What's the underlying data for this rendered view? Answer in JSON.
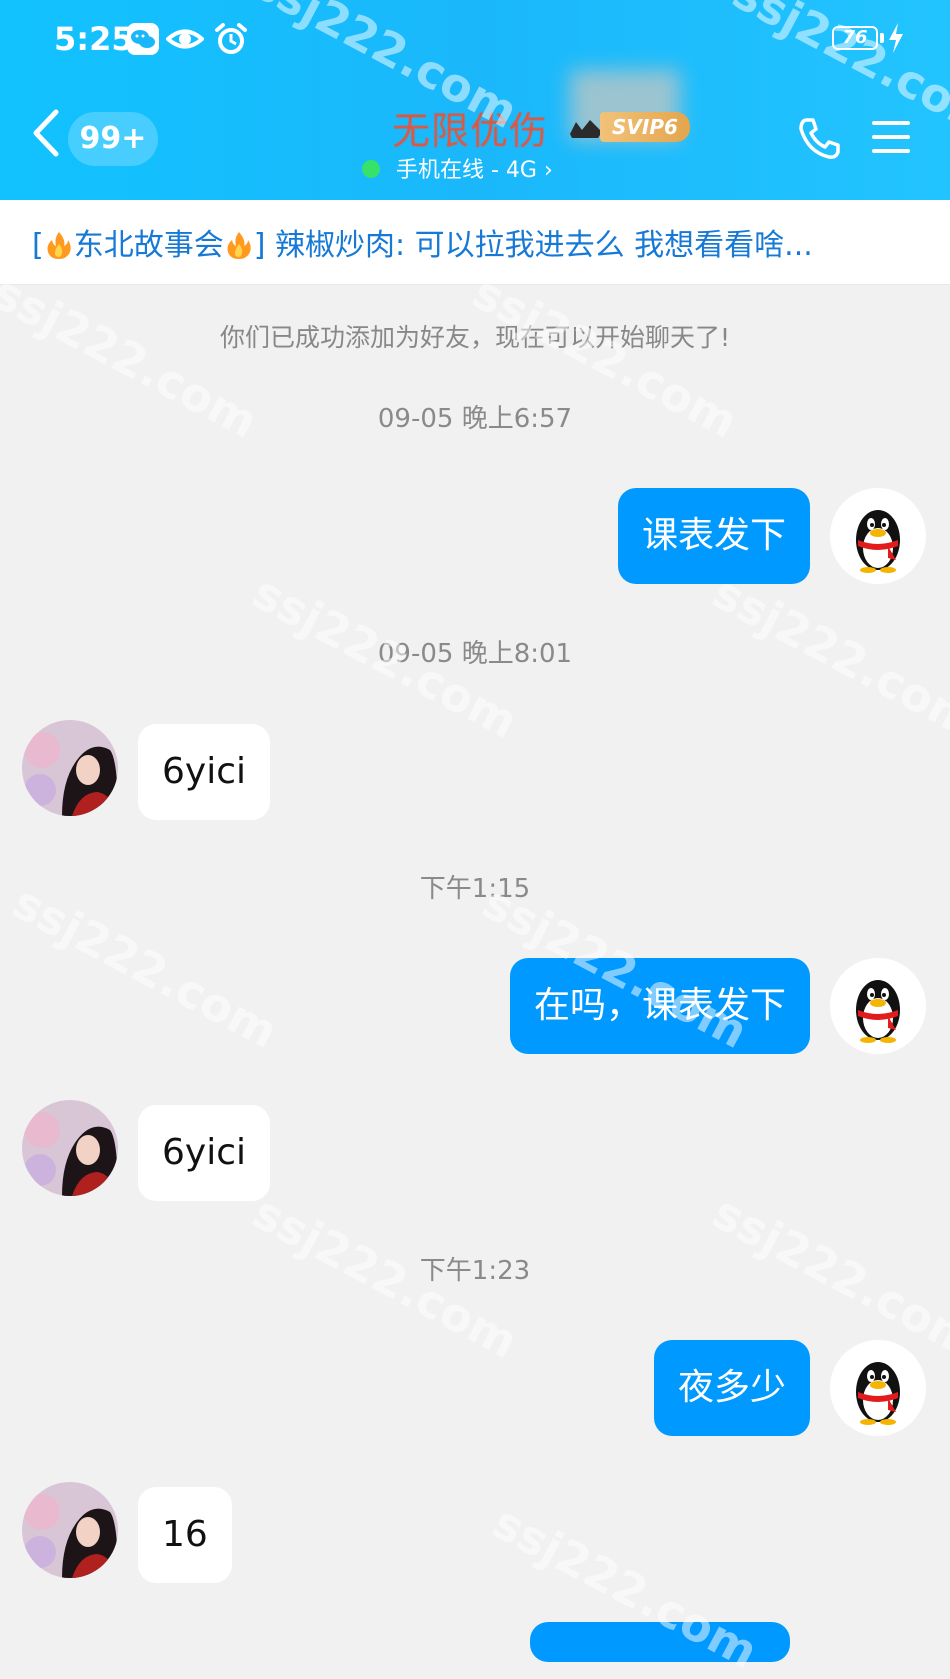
{
  "status_bar": {
    "time": "5:25",
    "battery": "76"
  },
  "header": {
    "back_count": "99+",
    "contact_name": "无限优伤",
    "vip_badge": "SVIP6",
    "online_status": "手机在线 - 4G ›"
  },
  "banner": {
    "bracket_open": "[",
    "group_name": "东北故事会",
    "bracket_close": "]",
    "message": " 辣椒炒肉: 可以拉我进去么 我想看看啥..."
  },
  "chat": {
    "system_message": "你们已成功添加为好友，现在可以开始聊天了!",
    "messages": [
      {
        "time": "09-05 晚上6:57",
        "direction": "out",
        "text": "课表发下"
      },
      {
        "time": "09-05 晚上8:01",
        "direction": "in",
        "text": "6yici"
      },
      {
        "time": "下午1:15",
        "direction": "out",
        "text": "在吗，课表发下"
      },
      {
        "direction": "in",
        "text": "6yici"
      },
      {
        "time": "下午1:23",
        "direction": "out",
        "text": "夜多少"
      },
      {
        "direction": "in",
        "text": "16"
      }
    ]
  },
  "watermark": "ssj222.com",
  "colors": {
    "header": "#1ab8fb",
    "bubble_out": "#0099ff",
    "banner_text": "#1779d6"
  },
  "icons": [
    "wechat-icon",
    "eye-icon",
    "alarm-icon",
    "back-icon",
    "phone-icon",
    "menu-icon",
    "qq-penguin-icon"
  ]
}
